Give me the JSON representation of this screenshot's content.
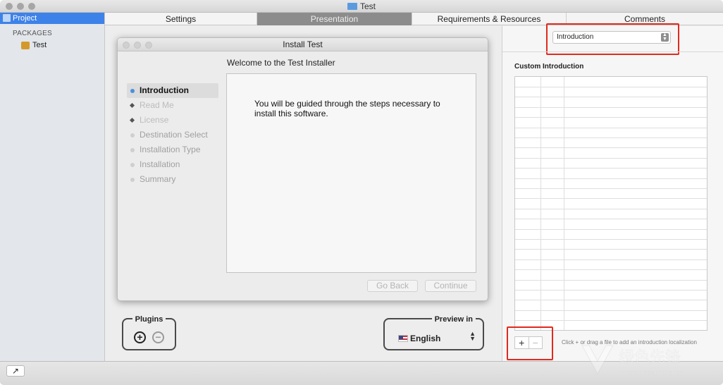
{
  "window": {
    "title": "Test"
  },
  "sidebar": {
    "project_label": "Project",
    "packages_header": "PACKAGES",
    "packages": [
      {
        "label": "Test"
      }
    ]
  },
  "tabs": [
    {
      "label": "Settings",
      "active": false
    },
    {
      "label": "Presentation",
      "active": true
    },
    {
      "label": "Requirements & Resources",
      "active": false
    },
    {
      "label": "Comments",
      "active": false
    }
  ],
  "installer": {
    "title": "Install Test",
    "welcome": "Welcome to the Test Installer",
    "steps": [
      {
        "label": "Introduction",
        "state": "current"
      },
      {
        "label": "Read Me",
        "state": "disabled"
      },
      {
        "label": "License",
        "state": "disabled"
      },
      {
        "label": "Destination Select",
        "state": "pending"
      },
      {
        "label": "Installation Type",
        "state": "pending"
      },
      {
        "label": "Installation",
        "state": "pending"
      },
      {
        "label": "Summary",
        "state": "pending"
      }
    ],
    "body_line1": "You will be guided through the steps necessary to",
    "body_line2": "install this software.",
    "go_back": "Go Back",
    "continue": "Continue"
  },
  "plugins": {
    "label": "Plugins",
    "add": "+",
    "remove": "−"
  },
  "preview": {
    "label": "Preview in",
    "language": "English"
  },
  "right_panel": {
    "section_popup": "Introduction",
    "custom_title": "Custom Introduction",
    "add": "+",
    "remove": "−",
    "hint": "Click + or drag a file to add an introduction localization"
  },
  "colors": {
    "highlight": "#e02a1d",
    "selection": "#3d82e8"
  },
  "watermark": {
    "text": "绿色先锋",
    "url": "www.greenxf.com"
  }
}
